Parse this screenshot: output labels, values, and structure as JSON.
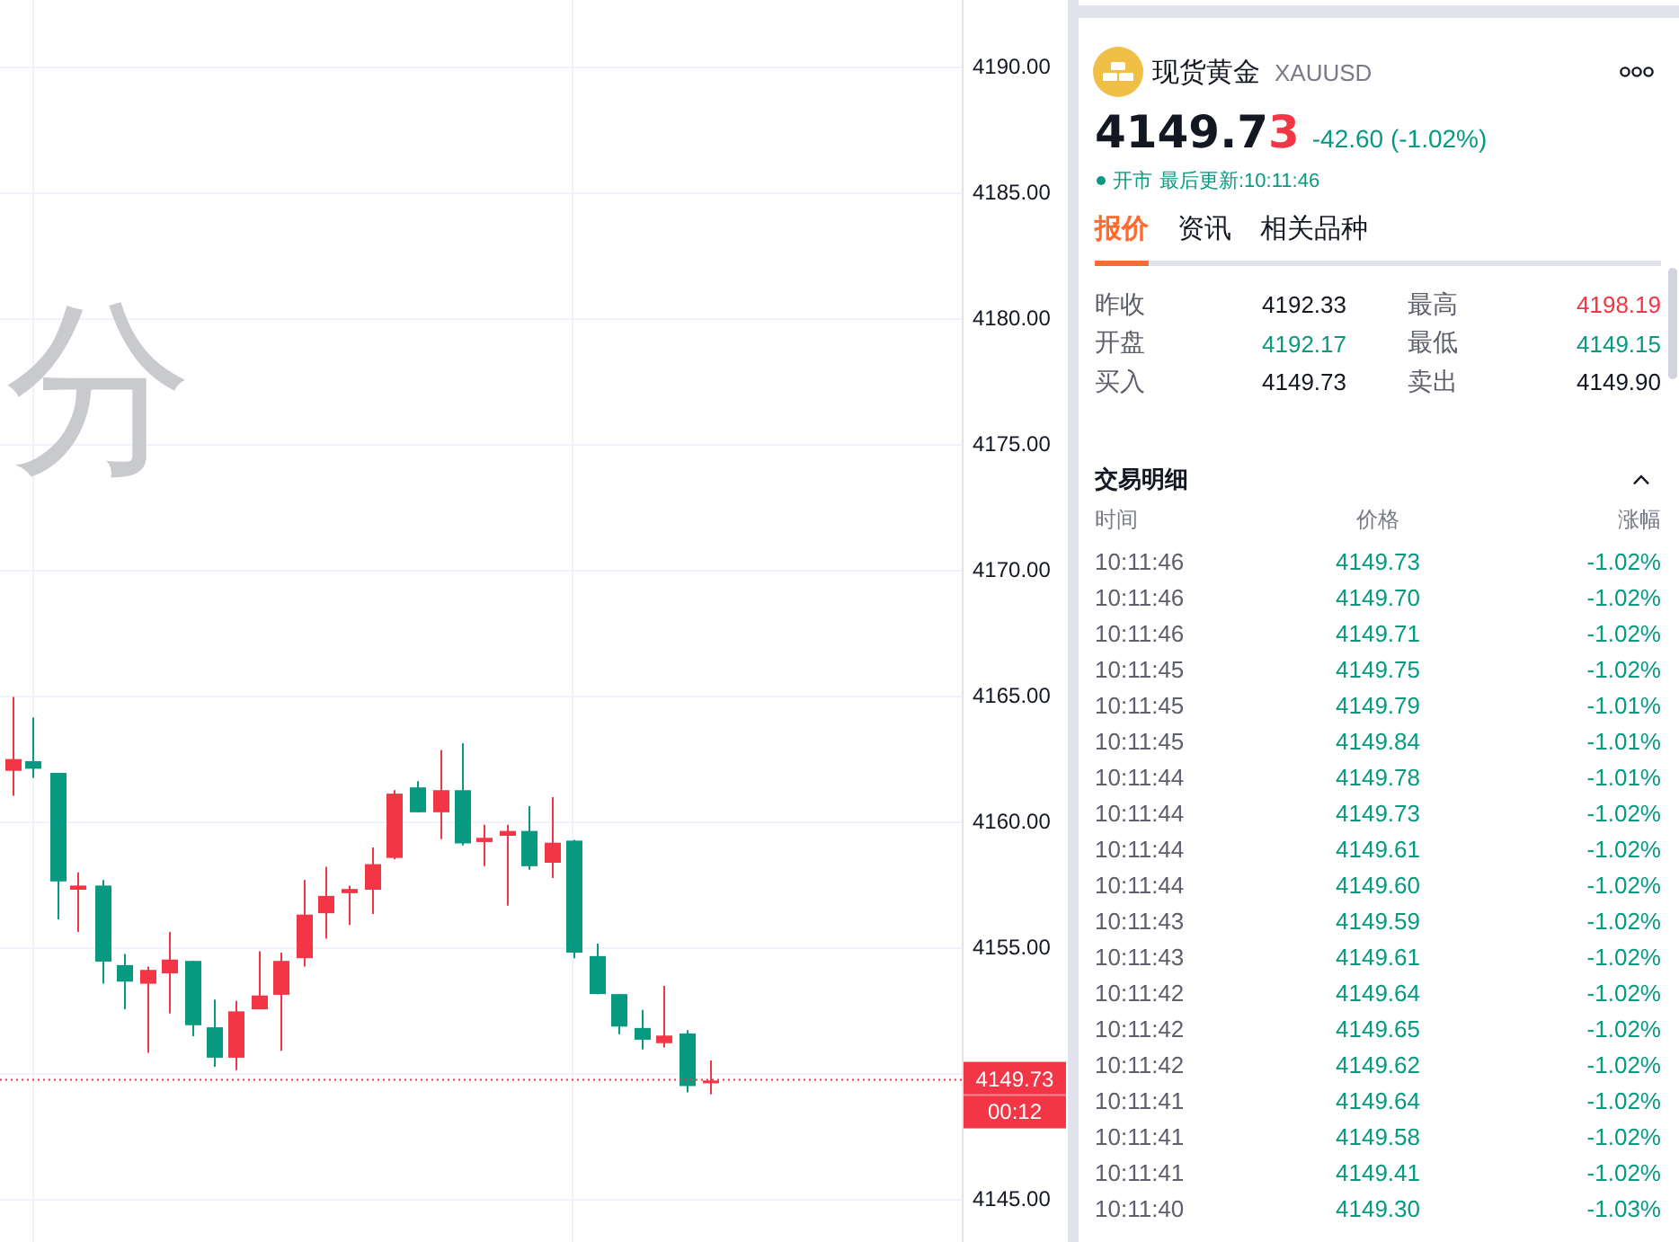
{
  "chart": {
    "watermark": "分",
    "price_axis": [
      "4190.00",
      "4185.00",
      "4180.00",
      "4175.00",
      "4170.00",
      "4165.00",
      "4160.00",
      "4155.00",
      "4145.00"
    ],
    "last_price": {
      "price": "4149.73",
      "countdown": "00:12"
    }
  },
  "quote": {
    "name": "现货黄金",
    "symbol": "XAUUSD",
    "price": {
      "unchanged": "4149.7",
      "changed": "3"
    },
    "change": "-42.60 (-1.02%)",
    "rising": false,
    "status": {
      "label": "开市",
      "open": true,
      "updated": "最后更新:10:11:46"
    }
  },
  "tabs": [
    {
      "label": "报价",
      "selected": true
    },
    {
      "label": "资讯",
      "selected": false
    },
    {
      "label": "相关品种",
      "selected": false
    }
  ],
  "stats": [
    {
      "label": "昨收",
      "value": "4192.33",
      "color": "#131722"
    },
    {
      "label": "最高",
      "value": "4198.19",
      "color": "#f23645"
    },
    {
      "label": "开盘",
      "value": "4192.17",
      "color": "#089981"
    },
    {
      "label": "最低",
      "value": "4149.15",
      "color": "#089981"
    },
    {
      "label": "买入",
      "value": "4149.73",
      "color": "#131722"
    },
    {
      "label": "卖出",
      "value": "4149.90",
      "color": "#131722"
    }
  ],
  "trades": {
    "title": "交易明细",
    "expanded": true,
    "columns": [
      "时间",
      "价格",
      "涨幅"
    ],
    "rows": [
      {
        "time": "10:11:46",
        "price": "4149.73",
        "change": "-1.02%",
        "rising": false
      },
      {
        "time": "10:11:46",
        "price": "4149.70",
        "change": "-1.02%",
        "rising": false
      },
      {
        "time": "10:11:46",
        "price": "4149.71",
        "change": "-1.02%",
        "rising": false
      },
      {
        "time": "10:11:45",
        "price": "4149.75",
        "change": "-1.02%",
        "rising": false
      },
      {
        "time": "10:11:45",
        "price": "4149.79",
        "change": "-1.01%",
        "rising": false
      },
      {
        "time": "10:11:45",
        "price": "4149.84",
        "change": "-1.01%",
        "rising": false
      },
      {
        "time": "10:11:44",
        "price": "4149.78",
        "change": "-1.01%",
        "rising": false
      },
      {
        "time": "10:11:44",
        "price": "4149.73",
        "change": "-1.02%",
        "rising": false
      },
      {
        "time": "10:11:44",
        "price": "4149.61",
        "change": "-1.02%",
        "rising": false
      },
      {
        "time": "10:11:44",
        "price": "4149.60",
        "change": "-1.02%",
        "rising": false
      },
      {
        "time": "10:11:43",
        "price": "4149.59",
        "change": "-1.02%",
        "rising": false
      },
      {
        "time": "10:11:43",
        "price": "4149.61",
        "change": "-1.02%",
        "rising": false
      },
      {
        "time": "10:11:42",
        "price": "4149.64",
        "change": "-1.02%",
        "rising": false
      },
      {
        "time": "10:11:42",
        "price": "4149.65",
        "change": "-1.02%",
        "rising": false
      },
      {
        "time": "10:11:42",
        "price": "4149.62",
        "change": "-1.02%",
        "rising": false
      },
      {
        "time": "10:11:41",
        "price": "4149.64",
        "change": "-1.02%",
        "rising": false
      },
      {
        "time": "10:11:41",
        "price": "4149.58",
        "change": "-1.02%",
        "rising": false
      },
      {
        "time": "10:11:41",
        "price": "4149.41",
        "change": "-1.02%",
        "rising": false
      },
      {
        "time": "10:11:40",
        "price": "4149.30",
        "change": "-1.03%",
        "rising": false
      }
    ]
  }
}
